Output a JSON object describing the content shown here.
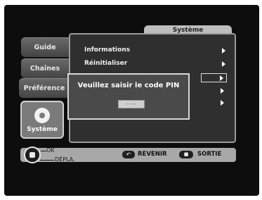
{
  "tabs": {
    "guide": "Guide",
    "chaines": "Chaînes",
    "preference": "Préférence",
    "systeme": "Système"
  },
  "panel": {
    "title": "Système",
    "items": [
      {
        "label": "Informations"
      },
      {
        "label": "Réinitialiser"
      }
    ]
  },
  "pin_dialog": {
    "message": "Veuillez saisir le code PIN",
    "field_value": "----"
  },
  "footer": {
    "ok_label": "OK",
    "move_label": "DÉPLA.",
    "back_label": "REVENIR",
    "exit_label": "SORTIE"
  },
  "colors": {
    "background": "#0d0d0d",
    "panel": "#2f2f2f",
    "footer": "#a8a8a8"
  },
  "icons": [
    "gear-icon",
    "dpad-icon",
    "back-key-icon",
    "exit-key-icon",
    "chevron-right-icon"
  ]
}
